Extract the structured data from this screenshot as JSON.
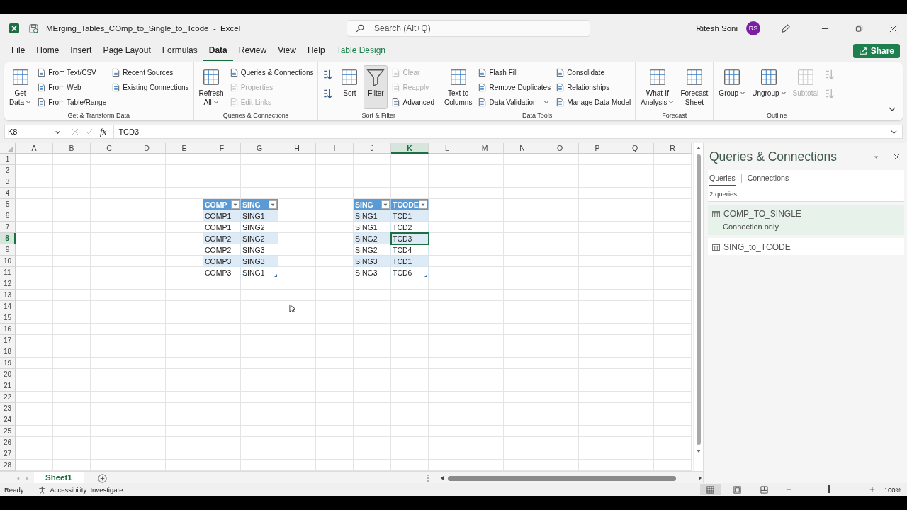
{
  "window": {
    "title": "MErging_Tables_COmp_to_Single_to_Tcode  -  Excel",
    "search_placeholder": "Search (Alt+Q)",
    "user": "Ritesh Soni",
    "avatar": "RS"
  },
  "menu_tabs": [
    {
      "label": "File",
      "selected": false,
      "kind": "normal"
    },
    {
      "label": "Home",
      "selected": false,
      "kind": "normal"
    },
    {
      "label": "Insert",
      "selected": false,
      "kind": "normal"
    },
    {
      "label": "Page Layout",
      "selected": false,
      "kind": "normal"
    },
    {
      "label": "Formulas",
      "selected": false,
      "kind": "normal"
    },
    {
      "label": "Data",
      "selected": true,
      "kind": "normal"
    },
    {
      "label": "Review",
      "selected": false,
      "kind": "normal"
    },
    {
      "label": "View",
      "selected": false,
      "kind": "normal"
    },
    {
      "label": "Help",
      "selected": false,
      "kind": "normal"
    },
    {
      "label": "Table Design",
      "selected": false,
      "kind": "contextual"
    }
  ],
  "share": "Share",
  "ribbon": [
    {
      "label": "Get & Transform Data",
      "columns": [
        [
          {
            "kind": "large",
            "label": "Get\nData",
            "disabled": false,
            "dropdown": true,
            "pressed": false
          }
        ],
        [
          {
            "kind": "small",
            "label": "From Text/CSV",
            "disabled": false,
            "dropdown": false,
            "pressed": false
          },
          {
            "kind": "small",
            "label": "From Web",
            "disabled": false,
            "dropdown": false,
            "pressed": false
          },
          {
            "kind": "small",
            "label": "From Table/Range",
            "disabled": false,
            "dropdown": false,
            "pressed": false
          }
        ],
        [
          {
            "kind": "small",
            "label": "Recent Sources",
            "disabled": false,
            "dropdown": false,
            "pressed": false
          },
          {
            "kind": "small",
            "label": "Existing Connections",
            "disabled": false,
            "dropdown": false,
            "pressed": false
          }
        ]
      ]
    },
    {
      "label": "Queries & Connections",
      "columns": [
        [
          {
            "kind": "large",
            "label": "Refresh\nAll",
            "disabled": false,
            "dropdown": true,
            "pressed": false
          }
        ],
        [
          {
            "kind": "small",
            "label": "Queries & Connections",
            "disabled": false,
            "dropdown": false,
            "pressed": false
          },
          {
            "kind": "small",
            "label": "Properties",
            "disabled": true,
            "dropdown": false,
            "pressed": false
          },
          {
            "kind": "small",
            "label": "Edit Links",
            "disabled": true,
            "dropdown": false,
            "pressed": false
          }
        ]
      ]
    },
    {
      "label": "Sort & Filter",
      "columns": [
        [
          {
            "kind": "icon",
            "disabled": false,
            "dropdown": false,
            "pressed": false
          },
          {
            "kind": "icon",
            "disabled": false,
            "dropdown": false,
            "pressed": false
          }
        ],
        [
          {
            "kind": "large",
            "label": "Sort",
            "disabled": false,
            "dropdown": false,
            "pressed": false
          }
        ],
        [
          {
            "kind": "toggle",
            "label": "Filter",
            "disabled": false,
            "dropdown": false,
            "pressed": true
          }
        ],
        [
          {
            "kind": "small",
            "label": "Clear",
            "disabled": true,
            "dropdown": false,
            "pressed": false
          },
          {
            "kind": "small",
            "label": "Reapply",
            "disabled": true,
            "dropdown": false,
            "pressed": false
          },
          {
            "kind": "small",
            "label": "Advanced",
            "disabled": false,
            "dropdown": false,
            "pressed": false
          }
        ]
      ]
    },
    {
      "label": "Data Tools",
      "columns": [
        [
          {
            "kind": "large",
            "label": "Text to\nColumns",
            "disabled": false,
            "dropdown": false,
            "pressed": false
          }
        ],
        [
          {
            "kind": "small",
            "label": "Flash Fill",
            "disabled": false,
            "dropdown": false,
            "pressed": false
          },
          {
            "kind": "small",
            "label": "Remove Duplicates",
            "disabled": false,
            "dropdown": false,
            "pressed": false
          },
          {
            "kind": "small",
            "label": "Data Validation",
            "disabled": false,
            "dropdown": true,
            "pressed": false
          }
        ],
        [
          {
            "kind": "small",
            "label": "Consolidate",
            "disabled": false,
            "dropdown": false,
            "pressed": false
          },
          {
            "kind": "small",
            "label": "Relationships",
            "disabled": false,
            "dropdown": false,
            "pressed": false
          },
          {
            "kind": "small",
            "label": "Manage Data Model",
            "disabled": false,
            "dropdown": false,
            "pressed": false
          }
        ]
      ]
    },
    {
      "label": "Forecast",
      "columns": [
        [
          {
            "kind": "large",
            "label": "What-If\nAnalysis",
            "disabled": false,
            "dropdown": true,
            "pressed": false
          }
        ],
        [
          {
            "kind": "large",
            "label": "Forecast\nSheet",
            "disabled": false,
            "dropdown": false,
            "pressed": false
          }
        ]
      ]
    },
    {
      "label": "Outline",
      "columns": [
        [
          {
            "kind": "large",
            "label": "Group",
            "disabled": false,
            "dropdown": true,
            "pressed": false
          }
        ],
        [
          {
            "kind": "large",
            "label": "Ungroup",
            "disabled": false,
            "dropdown": true,
            "pressed": false
          }
        ],
        [
          {
            "kind": "large",
            "label": "Subtotal",
            "disabled": true,
            "dropdown": false,
            "pressed": false
          }
        ],
        [
          {
            "kind": "icon",
            "disabled": true,
            "dropdown": false,
            "pressed": false
          },
          {
            "kind": "icon",
            "disabled": true,
            "dropdown": false,
            "pressed": false
          }
        ]
      ]
    }
  ],
  "formula_bar": {
    "name_box": "K8",
    "fx": "fx",
    "value": "TCD3"
  },
  "sheet": {
    "columns": [
      "A",
      "B",
      "C",
      "D",
      "E",
      "F",
      "G",
      "H",
      "I",
      "J",
      "K",
      "L",
      "M",
      "N",
      "O",
      "P",
      "Q",
      "R"
    ],
    "rows": [
      "1",
      "2",
      "3",
      "4",
      "5",
      "6",
      "7",
      "8",
      "9",
      "10",
      "11",
      "12",
      "13",
      "14",
      "15",
      "16",
      "17",
      "18",
      "19",
      "20",
      "21",
      "22",
      "23",
      "24",
      "25",
      "26",
      "27",
      "28"
    ],
    "tables": [
      {
        "headers": [
          "COMP",
          "SING"
        ],
        "rows": [
          [
            "COMP1",
            "SING1"
          ],
          [
            "COMP1",
            "SING2"
          ],
          [
            "COMP2",
            "SING2"
          ],
          [
            "COMP2",
            "SING3"
          ],
          [
            "COMP3",
            "SING3"
          ],
          [
            "COMP3",
            "SING1"
          ]
        ]
      },
      {
        "headers": [
          "SING",
          "TCODE"
        ],
        "rows": [
          [
            "SING1",
            "TCD1"
          ],
          [
            "SING1",
            "TCD2"
          ],
          [
            "SING2",
            "TCD3"
          ],
          [
            "SING2",
            "TCD4"
          ],
          [
            "SING3",
            "TCD1"
          ],
          [
            "SING3",
            "TCD6"
          ]
        ]
      }
    ]
  },
  "panel": {
    "title": "Queries & Connections",
    "tabs": [
      {
        "label": "Queries",
        "selected": true
      },
      {
        "label": "Connections",
        "selected": false
      }
    ],
    "count": "2 queries",
    "items": [
      {
        "name": "COMP_TO_SINGLE",
        "detail": "Connection only.",
        "selected": true
      },
      {
        "name": "SING_to_TCODE",
        "selected": false
      }
    ]
  },
  "sheet_tabs": [
    {
      "label": "Sheet1",
      "selected": true
    }
  ],
  "status": {
    "ready": "Ready",
    "accessibility": "Accessibility: Investigate",
    "views": [
      {
        "kind": "normal",
        "selected": true
      },
      {
        "kind": "page-layout",
        "selected": false
      },
      {
        "kind": "page-break",
        "selected": false
      }
    ],
    "zoom_slider": {
      "level": 0.5
    },
    "zoom": "100%"
  }
}
